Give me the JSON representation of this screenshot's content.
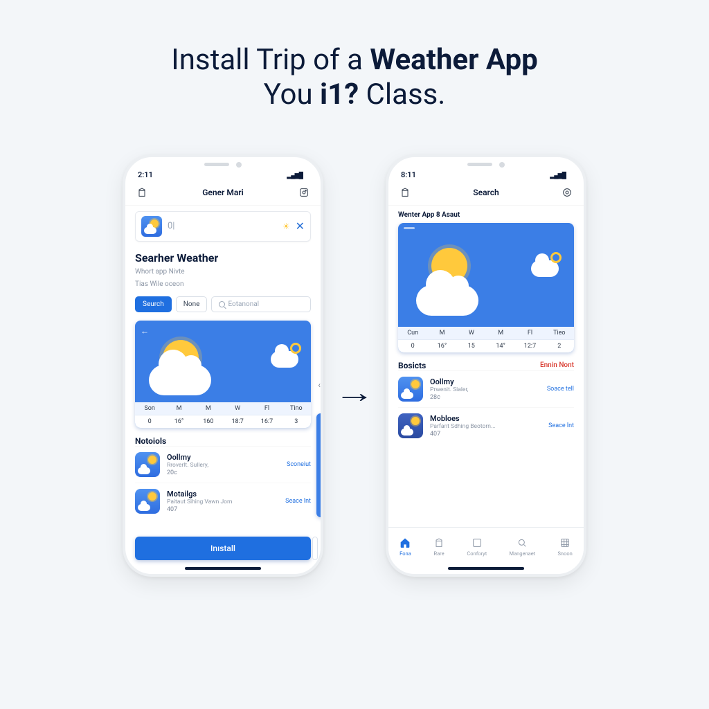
{
  "headline": {
    "part1": "Install Trip of a ",
    "bold": "Weather App",
    "line2a": "You ",
    "line2b": "i1?",
    "line2c": " Class."
  },
  "phone1": {
    "time": "2:11",
    "nav_title": "Gener Mari",
    "search_input_text": "0|",
    "section_title": "Searher Weather",
    "sub1": "Whort app Nivte",
    "sub2": "Tias Wile oceon",
    "pill_search": "Seurch",
    "pill_none": "None",
    "search_placeholder": "Eotanonal",
    "forecast": {
      "days": [
        "Son",
        "M",
        "M",
        "W",
        "Fl",
        "Tino"
      ],
      "vals": [
        "0",
        "16°",
        "160",
        "18:7",
        "16:7",
        "3"
      ]
    },
    "list_header": "Notoiols",
    "items": [
      {
        "name": "Oollmy",
        "desc": "Rroverlt. Sullery,",
        "meta": "20c",
        "action": "Sconeiut"
      },
      {
        "name": "Motailgs",
        "desc": "Paitaut Sihing Vawn Jom",
        "meta": "407",
        "action": "Seace lnt"
      }
    ],
    "install_label": "Inıstall"
  },
  "phone2": {
    "time": "8:11",
    "nav_title": "Search",
    "subtitle": "Wenter App 8 Asaut",
    "forecast": {
      "days": [
        "Cun",
        "M",
        "W",
        "M",
        "Fl",
        "Tieo"
      ],
      "vals": [
        "0",
        "16°",
        "15",
        "14°",
        "12:7",
        "2"
      ]
    },
    "list_header": "Bosicts",
    "list_link": "Ennin Nont",
    "items": [
      {
        "name": "Oollmy",
        "desc": "Prwenit. Sialer,",
        "meta": "28c",
        "action": "Soace tell"
      },
      {
        "name": "Mobloes",
        "desc": "Parfant Sdhing Beotorn...",
        "meta": "407",
        "action": "Seace lnt"
      }
    ],
    "tabs": [
      "Fona",
      "Rare",
      "Conforyt",
      "Mangenaet",
      "Snoon"
    ]
  }
}
